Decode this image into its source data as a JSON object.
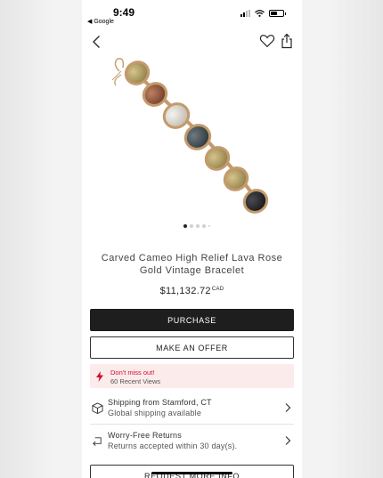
{
  "status_bar": {
    "time": "9:49",
    "back_app": "◀ Google"
  },
  "product": {
    "title": "Carved Cameo High Relief Lava Rose Gold Vintage Bracelet",
    "price": "$11,132.72",
    "currency": "CAD",
    "image_pager": {
      "total": 5,
      "current": 1
    }
  },
  "actions": {
    "purchase": "PURCHASE",
    "make_offer": "MAKE AN OFFER",
    "request_info": "REQUEST MORE INFO"
  },
  "alert": {
    "title": "Don't miss out!",
    "subtitle": "60 Recent Views"
  },
  "shipping": {
    "title": "Shipping from Stamford, CT",
    "subtitle": "Global shipping available"
  },
  "returns": {
    "title": "Worry-Free Returns",
    "subtitle": "Returns accepted within 30 day(s)."
  },
  "icons": {
    "back": "chevron-left-icon",
    "favorite": "heart-icon",
    "share": "share-icon",
    "alert": "lightning-icon",
    "shipping": "package-icon",
    "returns": "return-arrow-icon",
    "chevron": "chevron-right-icon"
  },
  "colors": {
    "primary_button": "#1e1e1e",
    "alert_bg": "#fcebeb",
    "alert_text": "#c8102e"
  }
}
